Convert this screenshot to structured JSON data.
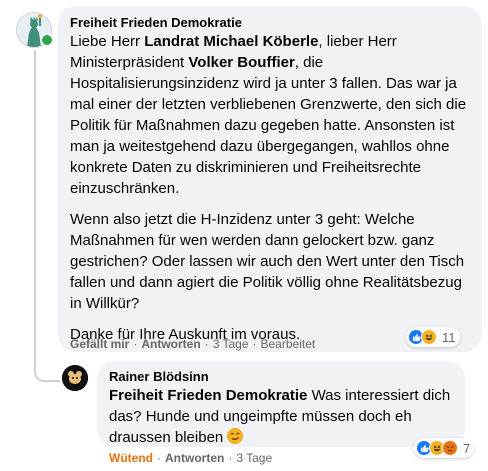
{
  "comment1": {
    "author": "Freiheit Frieden Demokratie",
    "para1": {
      "t1": "Liebe Herr ",
      "n1": "Landrat Michael Köberle",
      "t2": ", lieber Herr Ministerpräsident ",
      "n2": "Volker Bouffier",
      "t3": ", die Hospitalisierungsinzidenz wird ja unter 3 fallen. Das war ja mal einer der letzten verbliebenen Grenzwerte, den sich die Politik für Maßnahmen dazu gegeben hatte. Ansonsten ist man ja weitestgehend dazu übergegangen, wahllos ohne konkrete Daten zu diskriminieren und Freiheitsrechte einzuschränken."
    },
    "para2": "Wenn also jetzt die H-Inzidenz unter 3 geht: Welche Maßnahmen für wen werden dann gelockert bzw. ganz gestrichen? Oder lassen wir auch den Wert unter den Tisch fallen und dann agiert die Politik völlig ohne Realitätsbezug in Willkür?",
    "para3": "Danke für Ihre Auskunft im voraus.",
    "reaction_count": "11",
    "actions": {
      "like": "Gefällt mir",
      "reply": "Antworten",
      "time": "3 Tage",
      "edited": "Bearbeitet"
    }
  },
  "comment2": {
    "author": "Rainer Blödsinn",
    "mention": "Freiheit Frieden Demokratie",
    "text": " Was interessiert dich das? Hunde und ungeimpfte müssen doch eh draussen bleiben ",
    "reaction_count": "7",
    "actions": {
      "like": "Wütend",
      "reply": "Antworten",
      "time": "3 Tage"
    }
  },
  "separator": "·",
  "colors": {
    "bubble": "#f0f2f5",
    "meta": "#65676b",
    "angry": "#e9710f",
    "like": "#1877f2"
  },
  "icons": [
    "statue-of-liberty-avatar",
    "online-status-icon",
    "like-reaction-icon",
    "haha-reaction-icon",
    "angry-reaction-icon",
    "rat-avatar",
    "smirk-emoji-icon"
  ]
}
